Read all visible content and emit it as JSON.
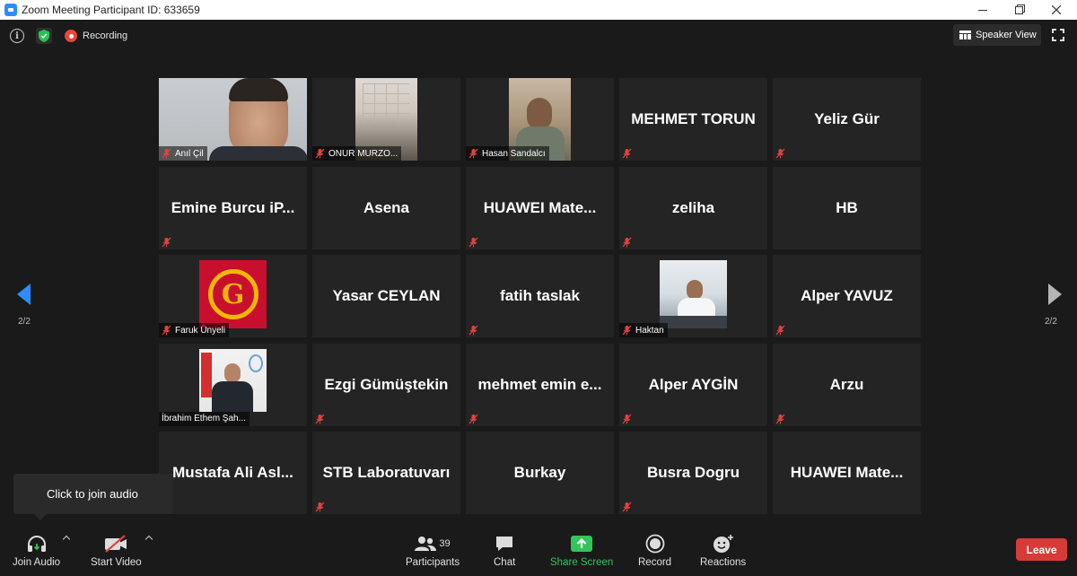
{
  "window": {
    "title": "Zoom Meeting Participant ID: 633659"
  },
  "topbar": {
    "recording_label": "Recording",
    "view_button_label": "Speaker View"
  },
  "pagination": {
    "left": "2/2",
    "right": "2/2"
  },
  "participants": [
    {
      "name": "Anıl Çil",
      "has_video": true,
      "muted": true
    },
    {
      "name": "ONUR MURZO...",
      "has_video": true,
      "muted": true
    },
    {
      "name": "Hasan Sandalcı",
      "has_video": true,
      "muted": true
    },
    {
      "name": "MEHMET TORUN",
      "has_video": false,
      "muted": true
    },
    {
      "name": "Yeliz Gür",
      "has_video": false,
      "muted": true
    },
    {
      "name": "Emine Burcu iP...",
      "has_video": false,
      "muted": true
    },
    {
      "name": "Asena",
      "has_video": false,
      "muted": false
    },
    {
      "name": "HUAWEI  Mate...",
      "has_video": false,
      "muted": true
    },
    {
      "name": "zeliha",
      "has_video": false,
      "muted": true
    },
    {
      "name": "HB",
      "has_video": false,
      "muted": false
    },
    {
      "name": "Faruk Ünyeli",
      "has_video": true,
      "muted": true
    },
    {
      "name": "Yasar CEYLAN",
      "has_video": false,
      "muted": false
    },
    {
      "name": "fatih taslak",
      "has_video": false,
      "muted": true
    },
    {
      "name": "Haktan",
      "has_video": true,
      "muted": true
    },
    {
      "name": "Alper YAVUZ",
      "has_video": false,
      "muted": true
    },
    {
      "name": "İbrahim Ethem Şah...",
      "has_video": true,
      "muted": false
    },
    {
      "name": "Ezgi Gümüştekin",
      "has_video": false,
      "muted": true
    },
    {
      "name": "mehmet  emin  e...",
      "has_video": false,
      "muted": true
    },
    {
      "name": "Alper AYGİN",
      "has_video": false,
      "muted": true
    },
    {
      "name": "Arzu",
      "has_video": false,
      "muted": true
    },
    {
      "name": "Mustafa Ali Asl...",
      "has_video": false,
      "muted": true
    },
    {
      "name": "STB Laboratuvarı",
      "has_video": false,
      "muted": true
    },
    {
      "name": "Burkay",
      "has_video": false,
      "muted": false
    },
    {
      "name": "Busra Dogru",
      "has_video": false,
      "muted": true
    },
    {
      "name": "HUAWEI  Mate...",
      "has_video": false,
      "muted": false
    }
  ],
  "tooltip": {
    "text": "Click to join audio"
  },
  "toolbar": {
    "join_audio": "Join Audio",
    "start_video": "Start Video",
    "participants": "Participants",
    "participants_count": "39",
    "chat": "Chat",
    "share_screen": "Share Screen",
    "record": "Record",
    "reactions": "Reactions",
    "leave": "Leave"
  },
  "colors": {
    "accent_blue": "#2d8cff",
    "share_green": "#31c55a",
    "leave_red": "#d73b37",
    "muted_red": "#e0423d"
  }
}
